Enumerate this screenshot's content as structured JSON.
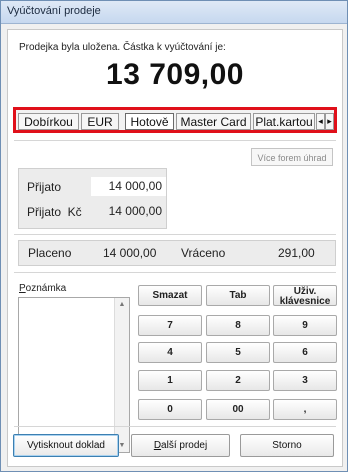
{
  "window": {
    "title": "Vyúčtování prodeje"
  },
  "message": "Prodejka byla uložena. Částka k vyúčtování je:",
  "amount": "13 709,00",
  "payment_tabs": [
    {
      "label": "Dobírkou",
      "active": false
    },
    {
      "label": "EUR",
      "active": false
    },
    {
      "label": "Hotově",
      "active": true
    },
    {
      "label": "Master Card",
      "active": false
    },
    {
      "label": "Plat.kartou",
      "active": false
    }
  ],
  "tab_scroll": {
    "left_icon": "◂",
    "right_icon": "▸"
  },
  "more_forms_button": "Více forem úhrad",
  "received": [
    {
      "label": "Přijato",
      "value": "14 000,00"
    },
    {
      "label": "Přijato  Kč",
      "value": "14 000,00"
    }
  ],
  "summary": {
    "paid_label": "Placeno",
    "paid_value": "14 000,00",
    "change_label": "Vráceno",
    "change_value": "291,00"
  },
  "note": {
    "label_first": "P",
    "label_rest": "oznámka",
    "value": "",
    "scroll_up": "▲",
    "scroll_down": "▼"
  },
  "keypad": {
    "smazat": "Smazat",
    "tab": "Tab",
    "user_kb_1": "Uživ.",
    "user_kb_2": "klávesnice",
    "k7": "7",
    "k8": "8",
    "k9": "9",
    "k4": "4",
    "k5": "5",
    "k6": "6",
    "k1": "1",
    "k2": "2",
    "k3": "3",
    "k0": "0",
    "k00": "00",
    "kdot": ","
  },
  "bottom": {
    "print": "Vytisknout doklad",
    "next_first": "D",
    "next_rest": "alší prodej",
    "cancel": "Storno"
  }
}
